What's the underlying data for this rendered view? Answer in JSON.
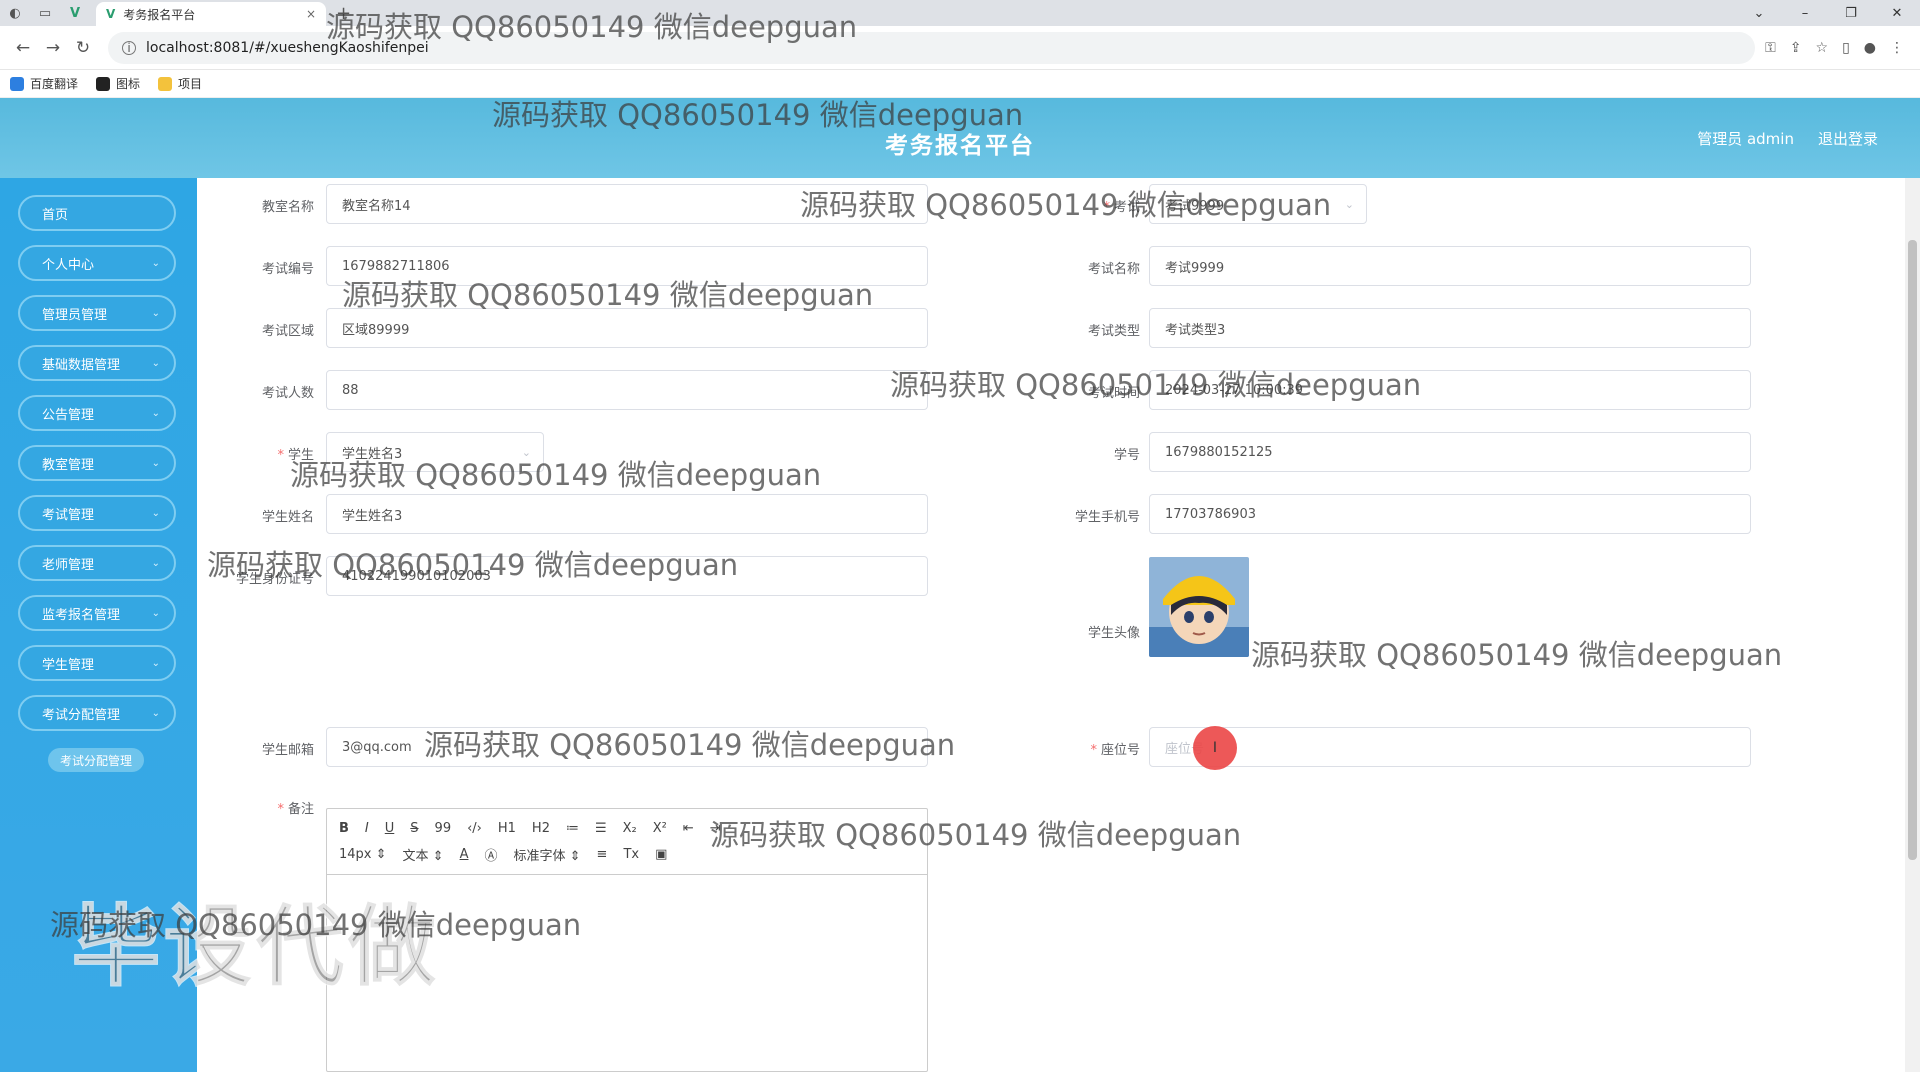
{
  "browser": {
    "tab_title": "考务报名平台",
    "tab_close": "×",
    "new_tab": "+",
    "url": "localhost:8081/#/xueshengKaoshifenpei",
    "bookmarks": [
      "百度翻译",
      "图标",
      "项目"
    ]
  },
  "header": {
    "title": "考务报名平台",
    "user_label": "管理员 admin",
    "logout": "退出登录"
  },
  "sidebar": {
    "items": [
      {
        "label": "首页"
      },
      {
        "label": "个人中心"
      },
      {
        "label": "管理员管理"
      },
      {
        "label": "基础数据管理"
      },
      {
        "label": "公告管理"
      },
      {
        "label": "教室管理"
      },
      {
        "label": "考试管理"
      },
      {
        "label": "老师管理"
      },
      {
        "label": "监考报名管理"
      },
      {
        "label": "学生管理"
      },
      {
        "label": "考试分配管理"
      }
    ],
    "active_sub": "考试分配管理"
  },
  "form": {
    "classroom_name": {
      "label": "教室名称",
      "value": "教室名称14"
    },
    "exam_select": {
      "label": "考试",
      "value": "考试9999"
    },
    "exam_no": {
      "label": "考试编号",
      "value": "1679882711806"
    },
    "exam_name": {
      "label": "考试名称",
      "value": "考试9999"
    },
    "exam_area": {
      "label": "考试区域",
      "value": "区域89999"
    },
    "exam_type": {
      "label": "考试类型",
      "value": "考试类型3"
    },
    "exam_count": {
      "label": "考试人数",
      "value": "88"
    },
    "exam_time": {
      "label": "考试时间",
      "value": "2024-03-27 10:00:39"
    },
    "student": {
      "label": "学生",
      "value": "学生姓名3"
    },
    "student_no": {
      "label": "学号",
      "value": "1679880152125"
    },
    "student_name": {
      "label": "学生姓名",
      "value": "学生姓名3"
    },
    "student_phone": {
      "label": "学生手机号",
      "value": "17703786903"
    },
    "student_id": {
      "label": "学生身份证号",
      "value": "410224199010102003"
    },
    "student_avatar": {
      "label": "学生头像"
    },
    "student_email": {
      "label": "学生邮箱",
      "value": "3@qq.com"
    },
    "seat_no": {
      "label": "座位号",
      "placeholder": "座位号"
    },
    "remark": {
      "label": "备注"
    }
  },
  "editor": {
    "row1": [
      "B",
      "I",
      "U",
      "S",
      "99",
      "‹/›",
      "H1",
      "H2",
      "≔",
      "☰",
      "X₂",
      "X²",
      "⇤",
      "⇥"
    ],
    "font_size": "14px",
    "text_type": "文本",
    "font_family": "标准字体"
  },
  "watermarks": [
    "源码获取 QQ86050149 微信deepguan",
    "源码获取 QQ86050149 微信deepguan",
    "源码获取 QQ86050149 微信deepguan",
    "源码获取 QQ86050149 微信deepguan",
    "源码获取 QQ86050149 微信deepguan",
    "源码获取 QQ86050149 微信deepguan",
    "源码获取 QQ86050149 微信deepguan",
    "源码获取 QQ86050149 微信deepguan",
    "源码获取 QQ86050149 微信deepguan",
    "源码获取 QQ86050149 微信deepguan",
    "源码获取 QQ86050149 微信deepguan"
  ],
  "big_watermark": "毕设代做"
}
